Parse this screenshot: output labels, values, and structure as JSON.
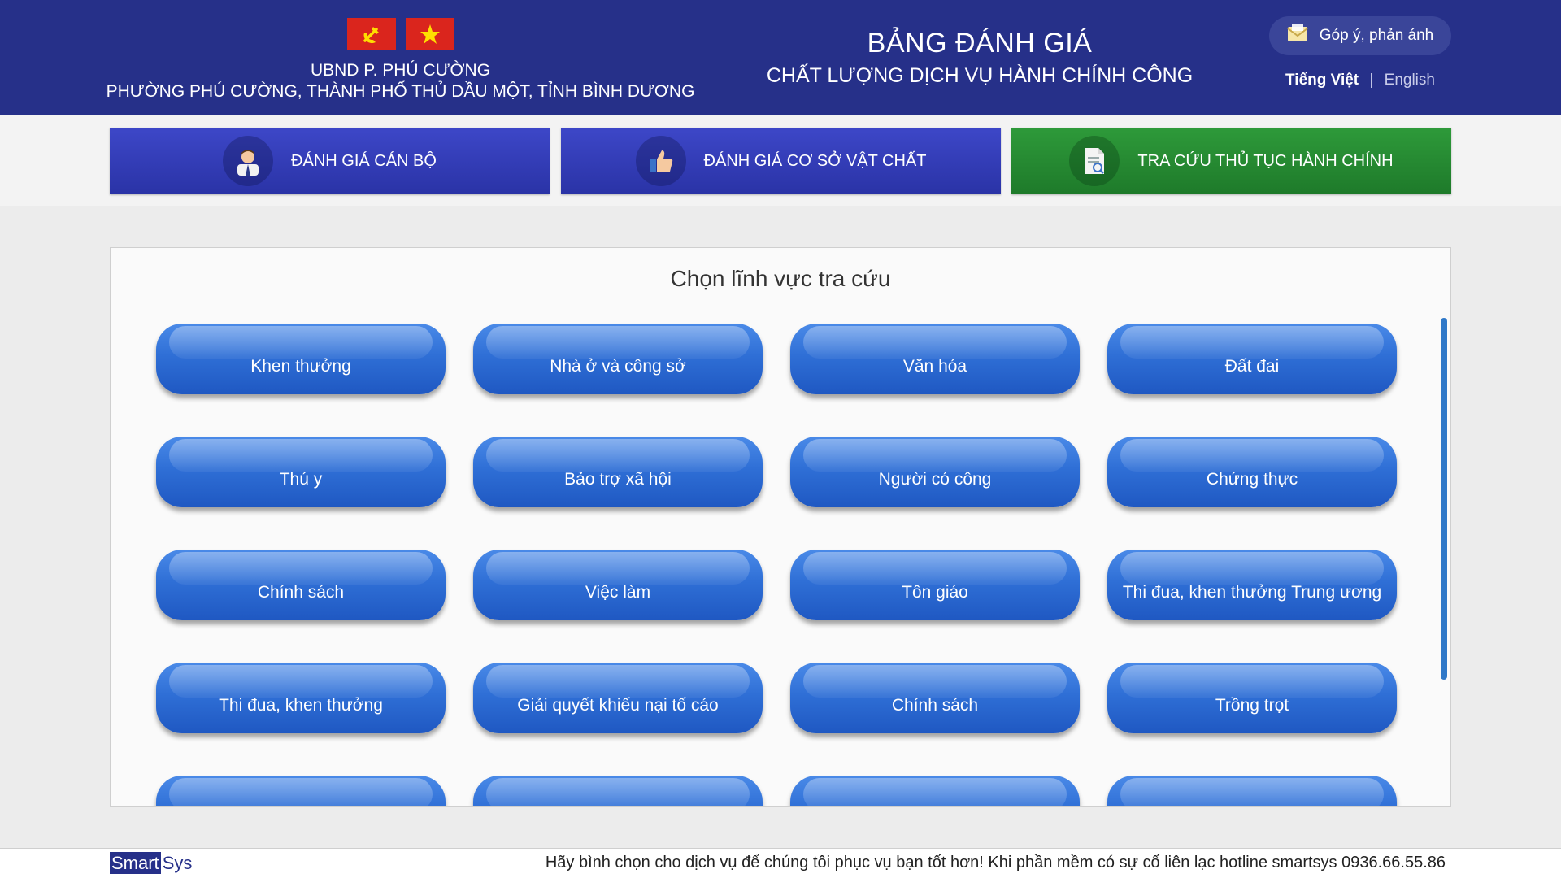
{
  "header": {
    "org_line1": "UBND P. PHÚ CƯỜNG",
    "org_line2": "PHƯỜNG PHÚ CƯỜNG, THÀNH PHỐ THỦ DẦU MỘT, TỈNH BÌNH DƯƠNG",
    "title_main": "BẢNG ĐÁNH GIÁ",
    "title_sub": "CHẤT LƯỢNG DỊCH VỤ HÀNH CHÍNH CÔNG",
    "feedback_label": "Góp ý, phản ánh",
    "languages": [
      {
        "label": "Tiếng Việt",
        "active": true
      },
      {
        "label": "English",
        "active": false
      }
    ],
    "lang_separator": "|"
  },
  "nav": [
    {
      "label": "ĐÁNH GIÁ CÁN BỘ",
      "icon": "officer-icon",
      "color": "#2f3ab5"
    },
    {
      "label": "ĐÁNH GIÁ CƠ SỞ VẬT CHẤT",
      "icon": "thumbs-up-icon",
      "color": "#2f3ab5"
    },
    {
      "label": "TRA CỨU THỦ TỤC HÀNH CHÍNH",
      "icon": "document-search-icon",
      "color": "#248a32"
    }
  ],
  "panel": {
    "title": "Chọn lĩnh vực tra cứu",
    "categories": [
      "Khen thưởng",
      "Nhà ở và công sở",
      "Văn hóa",
      "Đất đai",
      "Thú y",
      "Bảo trợ xã hội",
      "Người có công",
      "Chứng thực",
      "Chính sách",
      "Việc làm",
      "Tôn giáo",
      "Thi đua, khen thưởng Trung ương",
      "Thi đua, khen thưởng",
      "Giải quyết khiếu nại tố cáo",
      "Chính sách",
      "Trồng trọt",
      "",
      "",
      "",
      ""
    ]
  },
  "footer": {
    "brand_part1": "Smart",
    "brand_part2": "Sys",
    "message": "Hãy bình chọn cho dịch vụ để chúng tôi phục vụ bạn tốt hơn! Khi phần mềm có sự cố liên lạc hotline smartsys 0936.66.55.86"
  },
  "colors": {
    "header_bg": "#263089",
    "nav_blue": "#2f3ab5",
    "nav_green": "#248a32",
    "category_button": "#2f6fd6",
    "scrollbar": "#2f78c8"
  }
}
